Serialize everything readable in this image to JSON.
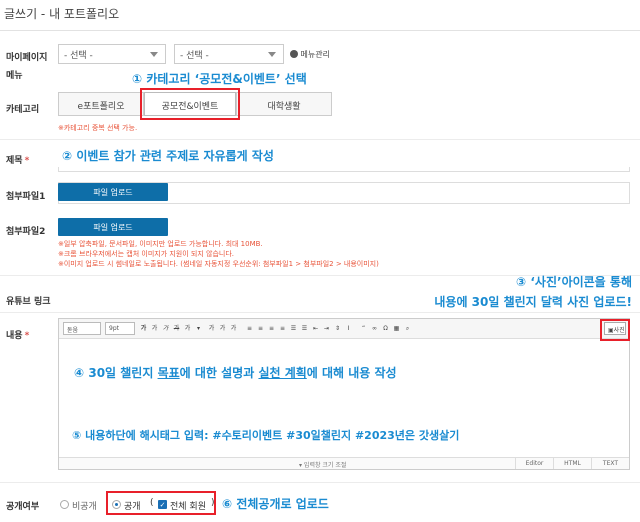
{
  "page": {
    "title": "글쓰기 - 내 포트폴리오"
  },
  "mypage_menu": {
    "label_line1": "마이페이지",
    "label_line2": "메뉴",
    "select1": "- 선택 -",
    "select2": "- 선택 -",
    "menu_manage": "메뉴관리"
  },
  "category": {
    "label": "카테고리",
    "tabs": [
      "e포트폴리오",
      "공모전&이벤트",
      "대학생활"
    ],
    "active_tab": "공모전&이벤트",
    "note": "※카테고리 중복 선택 가능."
  },
  "subject": {
    "label": "제목",
    "required_mark": "*",
    "value": ""
  },
  "attachment1": {
    "label": "첨부파일1",
    "button": "파일 업로드"
  },
  "attachment2": {
    "label": "첨부파일2",
    "button": "파일 업로드"
  },
  "attachment_notes": [
    "※일부 압축파일, 문서파일, 이미지만 업로드 가능합니다. 최대 10MB.",
    "※크롬 브라우저에서는 캡처 이미지가 지원이 되지 않습니다.",
    "※이미지 업로드 시 썸네일로 노출됩니다. (썸네일 자동지정 우선순위: 첨부파일1 > 첨부파일2 > 내용이미지)"
  ],
  "youtube": {
    "label": "유튜브 링크",
    "value": ""
  },
  "content": {
    "label": "내용",
    "required_mark": "*"
  },
  "editor": {
    "font_select": "돋움",
    "size_select": "9pt",
    "photo_button": "사진",
    "resize_hint": "▾ 입력창 크기 조절",
    "modes": [
      "Editor",
      "HTML",
      "TEXT"
    ]
  },
  "visibility": {
    "label": "공개여부",
    "private": "비공개",
    "public": "공개",
    "paren_open": "(",
    "paren_close": ")",
    "all_members": "전체 회원"
  },
  "callouts": {
    "c1": "① 카테고리 ‘공모전&이벤트’ 선택",
    "c2": "② 이벤트 참가 관련 주제로 자유롭게 작성",
    "c3_line1": "③ ‘사진’아이콘을 통해",
    "c3_line2": "내용에 30일 챌린지 달력 사진 업로드!",
    "c4_pre": "④ 30일 챌린지 ",
    "c4_u1": "목표",
    "c4_mid": "에 대한 설명과 ",
    "c4_u2": "실천 계획",
    "c4_post": "에 대해 내용 작성",
    "c5": "⑤  내용하단에 해시태그 입력: #수토리이벤트 #30일챌린지 #2023년은 갓생살기",
    "c6": "⑥ 전체공개로 업로드"
  },
  "colors": {
    "callout_blue": "#1a8bd1",
    "highlight_red": "#e8202a",
    "upload_blue": "#0e6ea8",
    "note_red": "#e8543a"
  }
}
